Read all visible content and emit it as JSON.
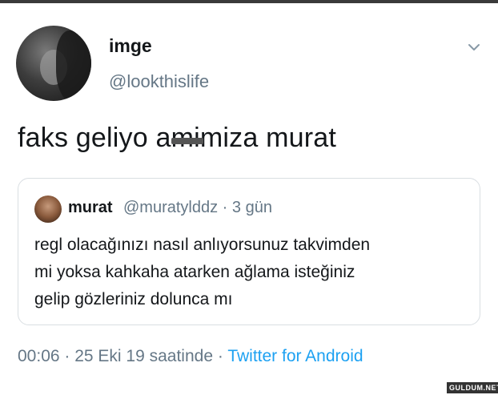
{
  "tweet": {
    "display_name": "imge",
    "handle": "@lookthislife",
    "text": "faks geliyo amimiza murat",
    "timestamp": "00:06 · 25 Eki 19 saatinde",
    "separator": " · ",
    "source": "Twitter for Android"
  },
  "quoted_tweet": {
    "display_name": "murat",
    "handle": "@muratylddz",
    "age": "3 gün",
    "meta": "@muratylddz · 3 gün",
    "lines": [
      "regl olacağınızı nasıl anlıyorsunuz takvimden",
      "mi yoksa kahkaha atarken ağlama isteğiniz",
      "gelip gözleriniz dolunca mı"
    ]
  },
  "icons": {
    "more": "chevron-down-icon"
  },
  "watermark": "GULDUM.NET",
  "colors": {
    "text": "#14171a",
    "secondary": "#657786",
    "link": "#1da1f2",
    "border": "#d9dee2"
  }
}
